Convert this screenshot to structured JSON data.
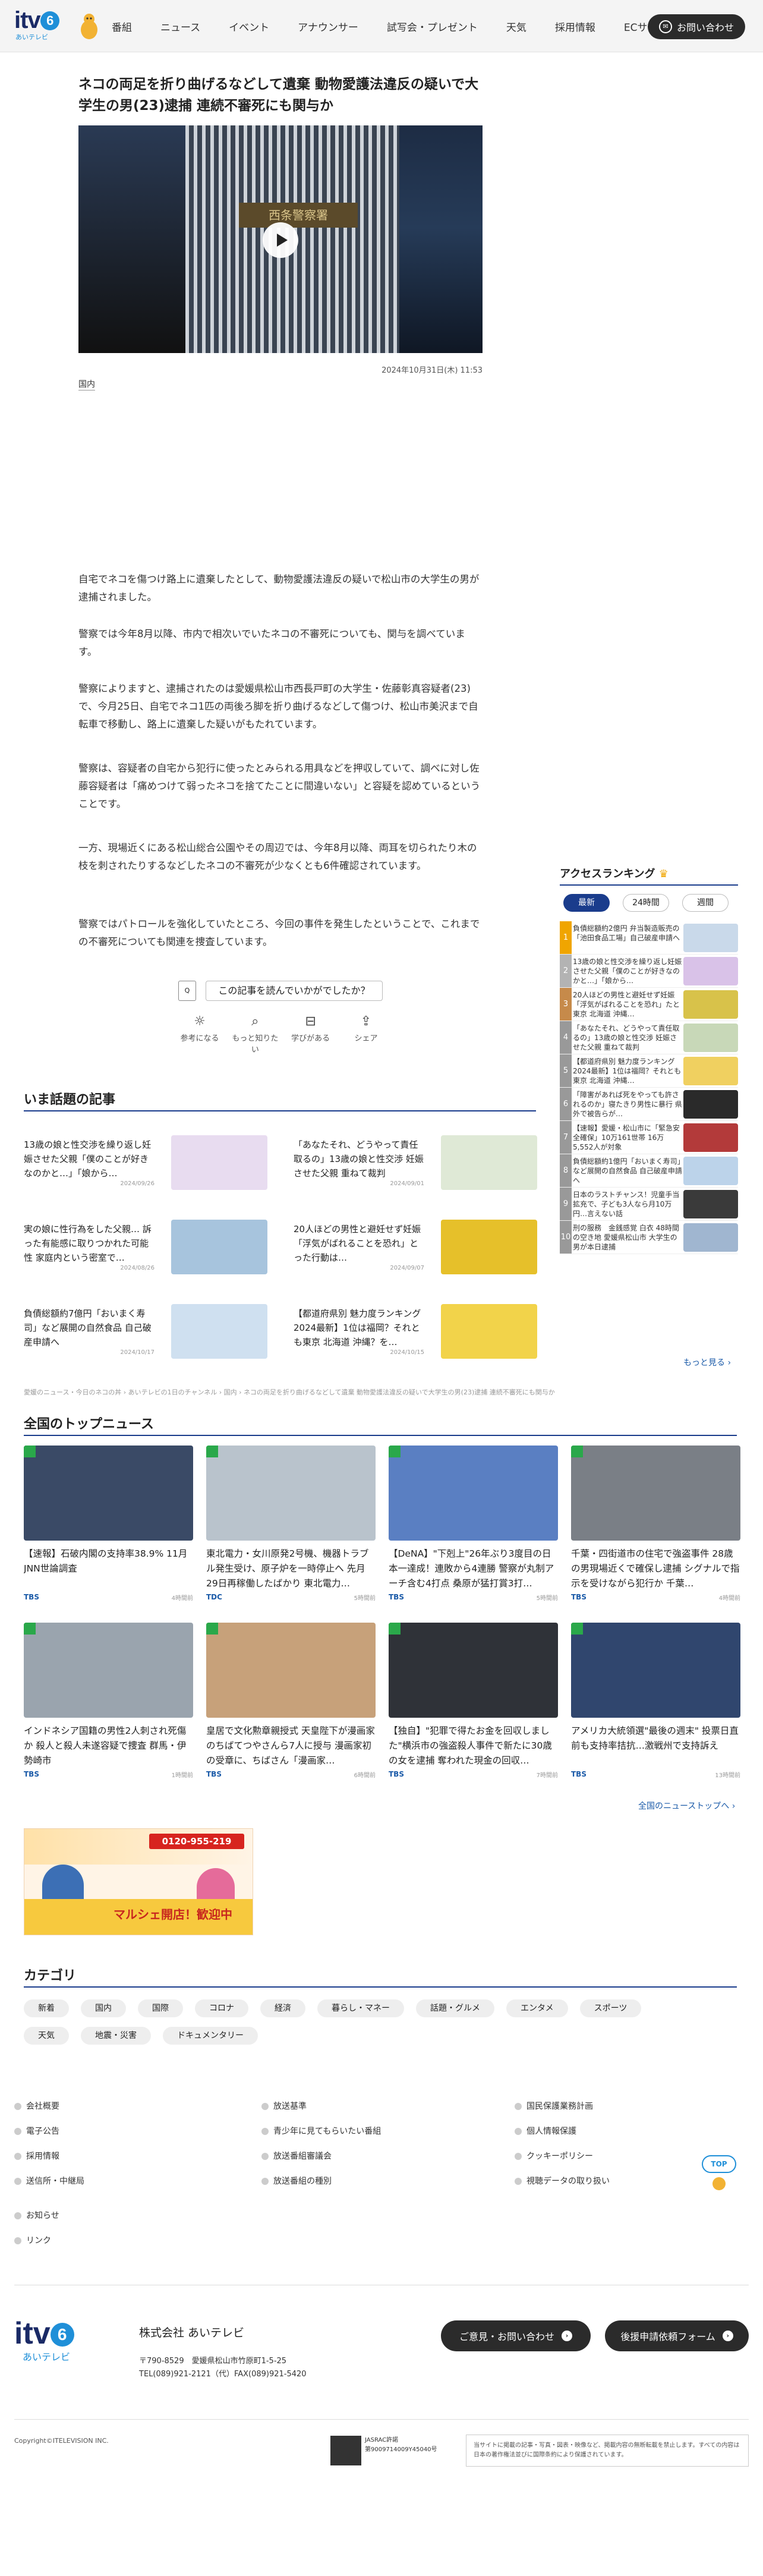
{
  "header": {
    "logo_text": "itv",
    "logo_six": "6",
    "logo_sub": "あいテレビ",
    "nav": [
      "番組",
      "ニュース",
      "イベント",
      "アナウンサー",
      "試写会・プレゼント",
      "天気",
      "採用情報",
      "ECサイト"
    ],
    "contact_label": "お問い合わせ"
  },
  "article": {
    "title": "ネコの両足を折り曲げるなどして遺棄 動物愛護法違反の疑いで大学生の男(23)逮捕 連続不審死にも関与か",
    "video_sign": "西条警察署",
    "date": "2024年10月31日(木) 11:53",
    "tag": "国内",
    "paragraphs": [
      "自宅でネコを傷つけ路上に遺棄したとして、動物愛護法違反の疑いで松山市の大学生の男が逮捕されました。",
      "警察では今年8月以降、市内で相次いでいたネコの不審死についても、関与を調べています。",
      "警察によりますと、逮捕されたのは愛媛県松山市西長戸町の大学生・佐藤彰真容疑者(23)で、今月25日、自宅でネコ1匹の両後ろ脚を折り曲げるなどして傷つけ、松山市美沢まで自転車で移動し、路上に遺棄した疑いがもたれています。",
      "警察は、容疑者の自宅から犯行に使ったとみられる用具などを押収していて、調べに対し佐藤容疑者は「痛めつけて弱ったネコを捨てたことに間違いない」と容疑を認めているということです。",
      "一方、現場近くにある松山総合公園やその周辺では、今年8月以降、両耳を切られたり木の枝を刺されたりするなどしたネコの不審死が少なくとも6件確認されています。",
      "警察ではパトロールを強化していたところ、今回の事件を発生したということで、これまでの不審死についても関連を捜査しています。"
    ],
    "feedback_icon": "Q",
    "feedback_question": "この記事を読んでいかがでしたか？",
    "reactions": [
      {
        "icon": "bulb-icon",
        "glyph": "☼",
        "label": "参考になる"
      },
      {
        "icon": "search-icon",
        "glyph": "⌕",
        "label": "もっと知りたい"
      },
      {
        "icon": "book-icon",
        "glyph": "⊟",
        "label": "学びがある"
      },
      {
        "icon": "share-icon",
        "glyph": "⇪",
        "label": "シェア"
      }
    ]
  },
  "ranking": {
    "title": "アクセスランキング",
    "tabs": [
      "最新",
      "24時間",
      "週間"
    ],
    "items": [
      {
        "num": "1",
        "text": "負債総額約2億円 弁当製造販売の「池田食品工場」自己破産申請へ",
        "color": "#f0a500",
        "thumb": "#c9d9ea"
      },
      {
        "num": "2",
        "text": "13歳の娘と性交渉を繰り返し妊娠させた父親「僕のことが好きなのかと…」「娘から…",
        "color": "#b3b3b3",
        "thumb": "#d9c2e8"
      },
      {
        "num": "3",
        "text": "20人ほどの男性と避妊せず妊娠「浮気がばれることを恐れ」たと東京 北海道 沖縄…",
        "color": "#c68a4a",
        "thumb": "#d8c24a"
      },
      {
        "num": "4",
        "text": "「あなたそれ、どうやって責任取るの」13歳の娘と性交渉 妊娠させた父親 重ねて裁判",
        "color": "#999",
        "thumb": "#c8d8b8"
      },
      {
        "num": "5",
        "text": "【都道府県別 魅力度ランキング2024最新】1位は福岡？それとも東京 北海道 沖縄…",
        "color": "#999",
        "thumb": "#f0d060"
      },
      {
        "num": "6",
        "text": "「障害があれば死をやっても許されるのか」寝たきり男性に暴行 県外で被告らが…",
        "color": "#999",
        "thumb": "#2a2a2a"
      },
      {
        "num": "7",
        "text": "【速報】愛媛・松山市に「緊急安全確保」10万161世帯 16万5,552人が対象",
        "color": "#999",
        "thumb": "#b33a3a"
      },
      {
        "num": "8",
        "text": "負債総額約1億円「おいまく寿司」など展開の自然食品 自己破産申請へ",
        "color": "#999",
        "thumb": "#bcd3ea"
      },
      {
        "num": "9",
        "text": "日本のラストチャンス！児童手当拡充で、子ども3人なら月10万円…言えない話",
        "color": "#999",
        "thumb": "#3a3a3a"
      },
      {
        "num": "10",
        "text": "刑の服務　金銭感覚 白衣 48時間の空き地 愛媛県松山市 大学生の男が本日逮捕",
        "color": "#999",
        "thumb": "#a0b6d0"
      }
    ],
    "more": "もっと見る ›"
  },
  "trending": {
    "title": "いま話題の記事",
    "items": [
      {
        "text": "13歳の娘と性交渉を繰り返し妊娠させた父親「僕のことが好きなのかと…」「娘から…",
        "date": "2024/09/26",
        "thumb": "#e8dcf0"
      },
      {
        "text": "「あなたそれ、どうやって責任取るの」13歳の娘と性交渉 妊娠させた父親 重ねて裁判",
        "date": "2024/09/01",
        "thumb": "#dfe9d6"
      },
      {
        "text": "実の娘に性行為をした父親… 訴った有能感に取りつかれた可能性 家庭内という密室で…",
        "date": "2024/08/26",
        "thumb": "#a7c4dd"
      },
      {
        "text": "20人ほどの男性と避妊せず妊娠「浮気がばれることを恐れ」とった行動は…",
        "date": "2024/09/07",
        "thumb": "#e6c02a"
      },
      {
        "text": "負債総額約7億円「おいまく寿司」など展開の自然食品 自己破産申請へ",
        "date": "2024/10/17",
        "thumb": "#cfe0f0"
      },
      {
        "text": "【都道府県別 魅力度ランキング2024最新】1位は福岡？それとも東京 北海道 沖縄？を…",
        "date": "2024/10/15",
        "thumb": "#f2d34a"
      }
    ]
  },
  "breadcrumb": "愛媛のニュース・今日のネコの丼 › あいテレビの1日のチャンネル › 国内 › ネコの両足を折り曲げるなどして遺棄 動物愛護法違反の疑いで大学生の男(23)逮捕 連続不審死にも関与か",
  "topnews": {
    "title": "全国のトップニュース",
    "items": [
      {
        "text": "【速報】石破内閣の支持率38.9% 11月JNN世論調査",
        "source": "TBS",
        "time": "4時間前",
        "thumb": "#3a4a66"
      },
      {
        "text": "東北電力・女川原発2号機、機器トラブル発生受け、原子炉を一時停止へ 先月29日再稼働したばかり 東北電力…",
        "source": "TDC",
        "time": "5時間前",
        "thumb": "#b9c3cc"
      },
      {
        "text": "【DeNA】\"下剋上\"26年ぶり3度目の日本一達成！連敗から4連勝 警察が丸制アーチ含む4打点 桑原が猛打賞3打…",
        "source": "TBS",
        "time": "5時間前",
        "thumb": "#5a7fc2"
      },
      {
        "text": "千葉・四街道市の住宅で強盗事件 28歳の男現場近くで確保し逮捕 シグナルで指示を受けながら犯行か 千葉…",
        "source": "TBS",
        "time": "4時間前",
        "thumb": "#7a7f86"
      },
      {
        "text": "インドネシア国籍の男性2人刺され死傷か 殺人と殺人未遂容疑で捜査 群馬・伊勢崎市",
        "source": "TBS",
        "time": "1時間前",
        "thumb": "#9aa4ae"
      },
      {
        "text": "皇居で文化勲章親授式 天皇陛下が漫画家のちばてつやさんら7人に授与 漫画家初の受章に、ちばさん「漫画家…",
        "source": "TBS",
        "time": "6時間前",
        "thumb": "#c7a17a"
      },
      {
        "text": "【独自】\"犯罪で得たお金を回収しました\"横浜市の強盗殺人事件で新たに30歳の女を逮捕 奪われた現金の回収…",
        "source": "TBS",
        "time": "7時間前",
        "thumb": "#2f3238"
      },
      {
        "text": "アメリカ大統領選\"最後の週末\" 投票日直前も支持率拮抗…激戦州で支持訴え",
        "source": "TBS",
        "time": "13時間前",
        "thumb": "#30466e"
      }
    ],
    "more": "全国のニューストップへ ›"
  },
  "banner": {
    "tel": "0120-955-219",
    "message": "マルシェ開店！歓迎中"
  },
  "category": {
    "title": "カテゴリ",
    "items": [
      "新着",
      "国内",
      "国際",
      "コロナ",
      "経済",
      "暮らし・マネー",
      "話題・グルメ",
      "エンタメ",
      "スポーツ",
      "天気",
      "地震・災害",
      "ドキュメンタリー"
    ]
  },
  "footer": {
    "col1": [
      "会社概要",
      "電子公告",
      "採用情報",
      "送信所・中継局"
    ],
    "col1b": [
      "お知らせ",
      "リンク"
    ],
    "col2": [
      "放送基準",
      "青少年に見てもらいたい番組",
      "放送番組審議会",
      "放送番組の種別"
    ],
    "col3": [
      "国民保護業務計画",
      "個人情報保護",
      "クッキーポリシー",
      "視聴データの取り扱い"
    ],
    "totop": "TOP",
    "company": "株式会社 あいテレビ",
    "address": "〒790-8529　愛媛県松山市竹原町1-5-25",
    "tel": "TEL(089)921-2121（代）FAX(089)921-5420",
    "btn_opinion": "ご意見・お問い合わせ",
    "btn_request": "後援申請依頼フォーム",
    "copyright": "Copyright©ITELEVISION INC.",
    "jasrac1": "JASRAC許諾",
    "jasrac2": "第9009714009Y45040号",
    "notice": "当サイトに掲載の記事・写真・図表・映像など、掲載内容の無断転載を禁止します。すべての内容は日本の著作権法並びに国際条約により保護されています。"
  }
}
